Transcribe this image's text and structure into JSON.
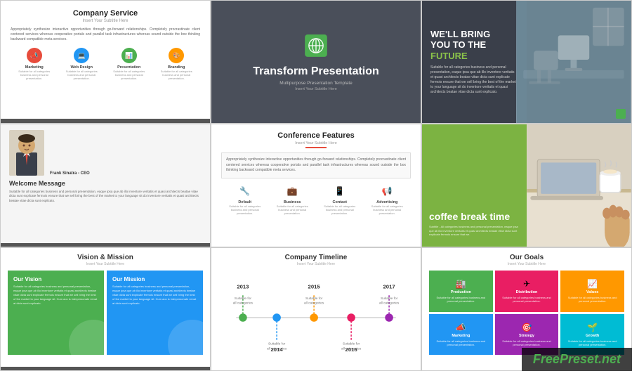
{
  "slides": [
    {
      "id": "slide-1",
      "title": "Company Service",
      "subtitle": "Insert Your Subtitle Here",
      "body": "Appropriately synthesize interactive opportunities through go-forward relationships. Completely procrastinate client centered services whereas cooperative portals and parallel task infrastructures whereas sound outside the box thinking backward compatible meta services.",
      "icons": [
        {
          "label": "Marketing",
          "color": "#e74c3c",
          "symbol": "📣",
          "desc": "Suitable for all categories business and personal presentation."
        },
        {
          "label": "Web Design",
          "color": "#2196F3",
          "symbol": "💻",
          "desc": "Suitable for all categories business and personal presentation."
        },
        {
          "label": "Presentation",
          "color": "#4CAF50",
          "symbol": "📊",
          "desc": "Suitable for all categories business and personal presentation."
        },
        {
          "label": "Branding",
          "color": "#FF9800",
          "symbol": "🎨",
          "desc": "Suitable for all categories business and personal presentation."
        }
      ]
    },
    {
      "id": "slide-2",
      "title": "Transform Presentation",
      "tagline": "Multipurpose Presentation Template",
      "sub_tagline": "Insert Your Subtitle Here"
    },
    {
      "id": "slide-3",
      "headline_line1": "WE'LL BRING",
      "headline_line2": "YOU TO THE",
      "headline_line3": "FUTURE",
      "small_text": "Suitable for all categories business and personal presentation, eaque ipsa que ab illo inventore veritatis et quasi architects beatae vitae dicta sunt explicate fermois ensure that we sell bring the best of the market to your language sit do inventore veritatis et quasi architects beatae vitae dicta sunt explicato."
    },
    {
      "id": "slide-4",
      "person_name": "Frank Sinatra - CEO",
      "welcome_title": "Welcome Message",
      "body": "Suitable for all categories business and personal presentation, eaque ipsa que ab illo inventore veritatis et quasi architects beatae vitae dicta sunt explicate fermois ensure that we sell bring the best of the market to your language sit do inventore veritatis et quasi architects beatae vitae dicta sunt explicato."
    },
    {
      "id": "slide-5",
      "title": "Conference Features",
      "subtitle": "Insert Your Subtitle Here",
      "body": "Appropriately synthesize interactive opportunities through go-forward relationships. Completely procrastinate client centered services whereas cooperative portals and parallel task infrastructures whereas sound outside the box thinking backward compatible meta services.",
      "features": [
        {
          "label": "Default",
          "symbol": "🔧",
          "desc": "Suitable for all categories business and personal presentation."
        },
        {
          "label": "Business",
          "symbol": "💼",
          "desc": "Suitable for all categories business and personal presentation."
        },
        {
          "label": "Contact",
          "symbol": "📱",
          "desc": "Suitable for all categories business and personal presentation."
        },
        {
          "label": "Advertising",
          "symbol": "📢",
          "desc": "Suitable for all categories business and personal presentation."
        }
      ]
    },
    {
      "id": "slide-6",
      "title": "coffee break time",
      "desc": "Subtitle - All categories business and personal presentation, eaque ipsa que ab illo inventore veritatis et quasi architects beatae vitae dicta sunt explicate fermois ensure that we."
    },
    {
      "id": "slide-7",
      "title": "Vision & Mission",
      "subtitle": "Insert Your Subtitle Here",
      "vision_title": "Our Vision",
      "vision_text": "Suitable for all categories business and personal presentation, eaque ipsa que ab illo inventore veritatis et quasi architects beatae vitae dicta sunt explicate fermois ensure that we sell bring the best of the market to your language sit. Cum aoc is interpersonate venat at dicta sunt explicato.",
      "mission_title": "Our Mission",
      "mission_text": "Suitable for all categories business and personal presentation, eaque ipsa que ab illo inventore veritatis et quasi architects beatae vitae dicta sunt explicate fermois ensure that we sell bring the best of the market to your language sit. Cum aoc is interpersonate venat at dicta sunt explicato."
    },
    {
      "id": "slide-8",
      "title": "Company Timeline",
      "subtitle": "Insert Your Subtitle Here",
      "years": [
        {
          "year": "2013",
          "text": "Suitable for all categories business and personal presentation.",
          "color": "#4CAF50",
          "position": "top"
        },
        {
          "year": "2014",
          "text": "Suitable for all categories business and personal presentation.",
          "color": "#2196F3",
          "position": "bottom"
        },
        {
          "year": "2015",
          "text": "Suitable for all categories business and personal presentation.",
          "color": "#FF9800",
          "position": "top"
        },
        {
          "year": "2016",
          "text": "Suitable for all categories business and personal presentation.",
          "color": "#E91E63",
          "position": "bottom"
        },
        {
          "year": "2017",
          "text": "Suitable for all categories business and personal presentation.",
          "color": "#9C27B0",
          "position": "top"
        }
      ]
    },
    {
      "id": "slide-9",
      "title": "Our Goals",
      "subtitle": "Insert Your Subtitle Here",
      "goals": [
        {
          "label": "Production",
          "color": "#4CAF50",
          "symbol": "🏭",
          "desc": "Suitable for all categories business and personal presentation."
        },
        {
          "label": "Distribution",
          "color": "#E91E63",
          "symbol": "✈",
          "desc": "Suitable for all categories business and personal presentation."
        },
        {
          "label": "Values",
          "color": "#FF9800",
          "symbol": "📈",
          "desc": "Suitable for all categories business and personal presentation."
        },
        {
          "label": "Marketing",
          "color": "#2196F3",
          "symbol": "📣",
          "desc": "Suitable for all categories business and personal presentation."
        },
        {
          "label": "Strategy",
          "color": "#9C27B0",
          "symbol": "🎯",
          "desc": "Suitable for all categories business and personal presentation."
        },
        {
          "label": "Growth",
          "color": "#00BCD4",
          "symbol": "🌱",
          "desc": "Suitable for all categories business and personal presentation."
        }
      ]
    }
  ],
  "watermark": {
    "prefix": "Free",
    "brand": "Preset",
    "suffix": ".net"
  }
}
